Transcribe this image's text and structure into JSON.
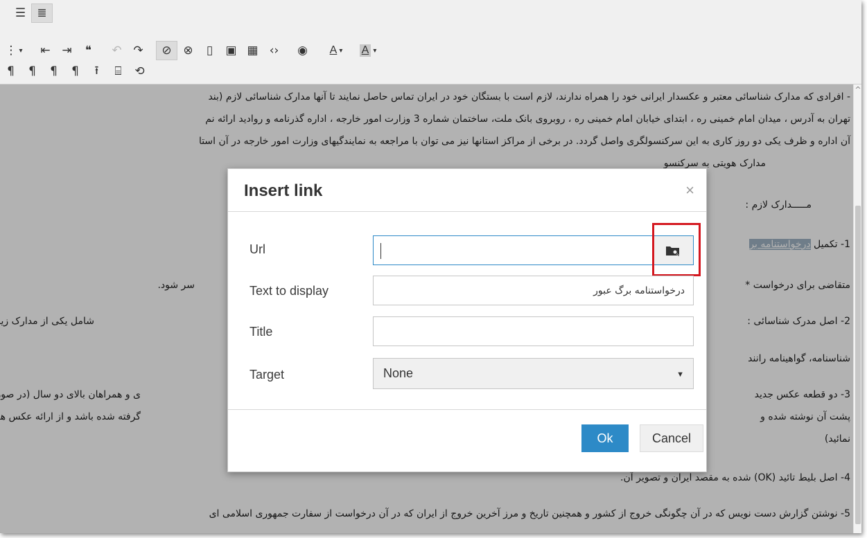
{
  "toolbar": {
    "row1": [
      {
        "icon": "align-justify-icon",
        "glyph": "☰",
        "pressed": false
      },
      {
        "icon": "align-justify-active-icon",
        "glyph": "≣",
        "pressed": true
      }
    ],
    "row2": [
      {
        "icon": "list-dropdown-icon",
        "glyph": "⋮",
        "caret": "▾"
      },
      {
        "icon": "outdent-icon",
        "glyph": "⇤"
      },
      {
        "icon": "indent-icon",
        "glyph": "⇥"
      },
      {
        "icon": "blockquote-icon",
        "glyph": "❝"
      },
      {
        "icon": "undo-icon",
        "glyph": "↶",
        "disabled": true
      },
      {
        "icon": "redo-icon",
        "glyph": "↷"
      },
      {
        "icon": "link-icon",
        "glyph": "🔗",
        "pressed": true
      },
      {
        "icon": "unlink-icon",
        "glyph": "⛓",
        "pressed": true
      },
      {
        "icon": "bookmark-icon",
        "glyph": "🔖"
      },
      {
        "icon": "image-icon",
        "glyph": "🖼"
      },
      {
        "icon": "media-icon",
        "glyph": "🎞"
      },
      {
        "icon": "code-icon",
        "glyph": "‹›"
      },
      {
        "icon": "preview-icon",
        "glyph": "👁"
      },
      {
        "icon": "text-color-icon",
        "glyph": "A",
        "caret": "▾"
      },
      {
        "icon": "background-color-icon",
        "glyph": "A",
        "caret": "▾"
      }
    ],
    "row3": [
      {
        "icon": "paragraph-ltr-icon",
        "glyph": "¶"
      },
      {
        "icon": "paragraph-rtl-icon",
        "glyph": "¶"
      },
      {
        "icon": "paragraph-mark-icon",
        "glyph": "¶"
      },
      {
        "icon": "paragraph-mark-2-icon",
        "glyph": "¶"
      },
      {
        "icon": "upload-icon",
        "glyph": "⭱"
      },
      {
        "icon": "page-break-icon",
        "glyph": "⌸"
      },
      {
        "icon": "restore-draft-icon",
        "glyph": "⟲"
      }
    ]
  },
  "document": {
    "lines": [
      "- افرادی که مدارک شناسائی معتبر و عکسدار ایرانی خود را همراه ندارند، لازم است با بستگان خود در ایران تماس حاصل نمایند تا آنها مدارک شناسائی لازم (بند",
      "تهران به آدرس ، میدان امام خمینی ره ، ابتدای خیابان امام خمینی ره ، روبروی بانک ملت، ساختمان شماره 3 وزارت امور خارجه ، اداره گذرنامه و روادید ارائه نم",
      "آن اداره و ظرف یکی دو روز کاری به این سرکنسولگری واصل گردد. در برخی از مراکز استانها نیز می توان با مراجعه به نمایندگیهای وزارت امور خارجه در آن استا",
      "مدارک هویتی به سرکنسو",
      "مـــــدارک لازم :",
      "متقاضی برای درخواست *",
      "سر شود.",
      "2- اصل مدرک شناسائی :",
      "شامل یکی از مدارک زیر:",
      "شناسنامه، گواهینامه رانند",
      "3- دو قطعه عکس جدید",
      "ی و همراهان بالای دو سال (در صورت وج",
      "پشت آن نوشته شده و",
      "گرفته شده باشد و از ارائه عکس های قد",
      "نمائید)",
      "4- اصل بلیط تائید (OK) شده به مقصد ایران و تصویر آن.",
      "5- نوشتن گزارش دست نویس که در آن چگونگی خروج از کشور و همچنین تاریخ و مرز آخرین خروج از ایران که در آن  درخواست از سفارت جمهوری اسلامی ای"
    ],
    "item1_prefix": "1- تکمیل",
    "item1_link": "درخواستنامه بر"
  },
  "dialog": {
    "title": "Insert link",
    "close_glyph": "×",
    "url_label": "Url",
    "url_value": "",
    "text_label": "Text to display",
    "text_value": "درخواستنامه برگ عبور",
    "title_label": "Title",
    "title_value": "",
    "target_label": "Target",
    "target_value": "None",
    "ok_label": "Ok",
    "cancel_label": "Cancel"
  },
  "colors": {
    "accent": "#2d8ac7",
    "highlight_box": "#d4171f"
  }
}
